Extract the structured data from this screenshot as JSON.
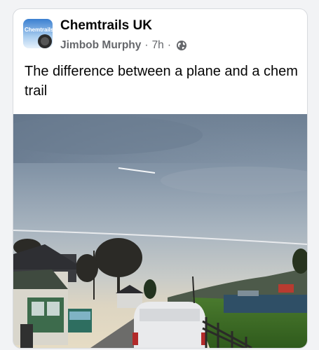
{
  "post": {
    "group_name": "Chemtrails UK",
    "author": "Jimbob Murphy",
    "separator": "·",
    "time": "7h",
    "privacy_icon": "globe-icon",
    "text": "The difference between a plane and a chem trail",
    "avatar_text": "Chemtrails"
  },
  "colors": {
    "card_bg": "#ffffff",
    "page_bg": "#f2f3f5",
    "primary_text": "#050505",
    "secondary_text": "#65676b"
  }
}
